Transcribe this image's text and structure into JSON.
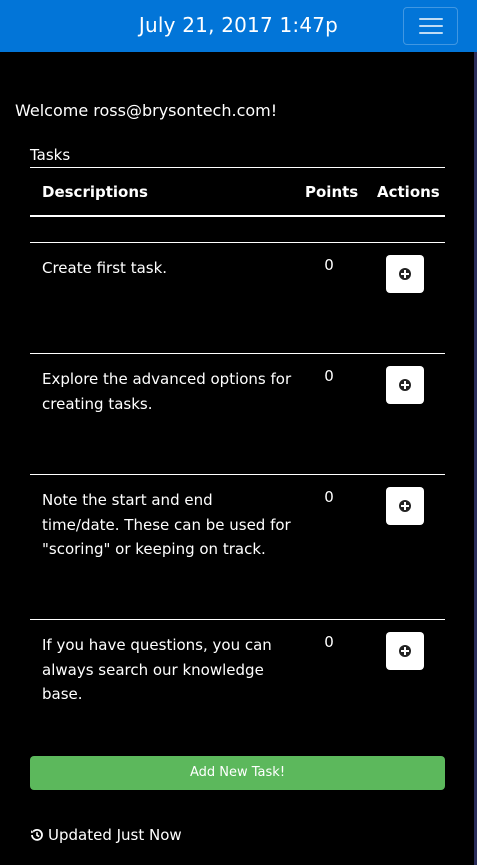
{
  "navbar": {
    "datetime": "July 21, 2017 1:47p",
    "background": "#0275d8",
    "menu_icon": "hamburger-icon"
  },
  "welcome": "Welcome ross@brysontech.com!",
  "tasks": {
    "caption": "Tasks",
    "headers": {
      "description": "Descriptions",
      "points": "Points",
      "actions": "Actions"
    },
    "rows": [
      {
        "description": "Create first task.",
        "points": "0",
        "action_icon": "plus-circle-icon"
      },
      {
        "description": "Explore the advanced options for creating tasks.",
        "points": "0",
        "action_icon": "plus-circle-icon"
      },
      {
        "description": "Note the start and end time/date. These can be used for \"scoring\" or keeping on track.",
        "points": "0",
        "action_icon": "plus-circle-icon"
      },
      {
        "description": "If you have questions, you can always search our knowledge base.",
        "points": "0",
        "action_icon": "plus-circle-icon"
      }
    ]
  },
  "add_button": {
    "label": "Add New Task!",
    "color": "#5cb85c"
  },
  "status": {
    "text": "Updated Just Now",
    "icon": "history-icon"
  }
}
